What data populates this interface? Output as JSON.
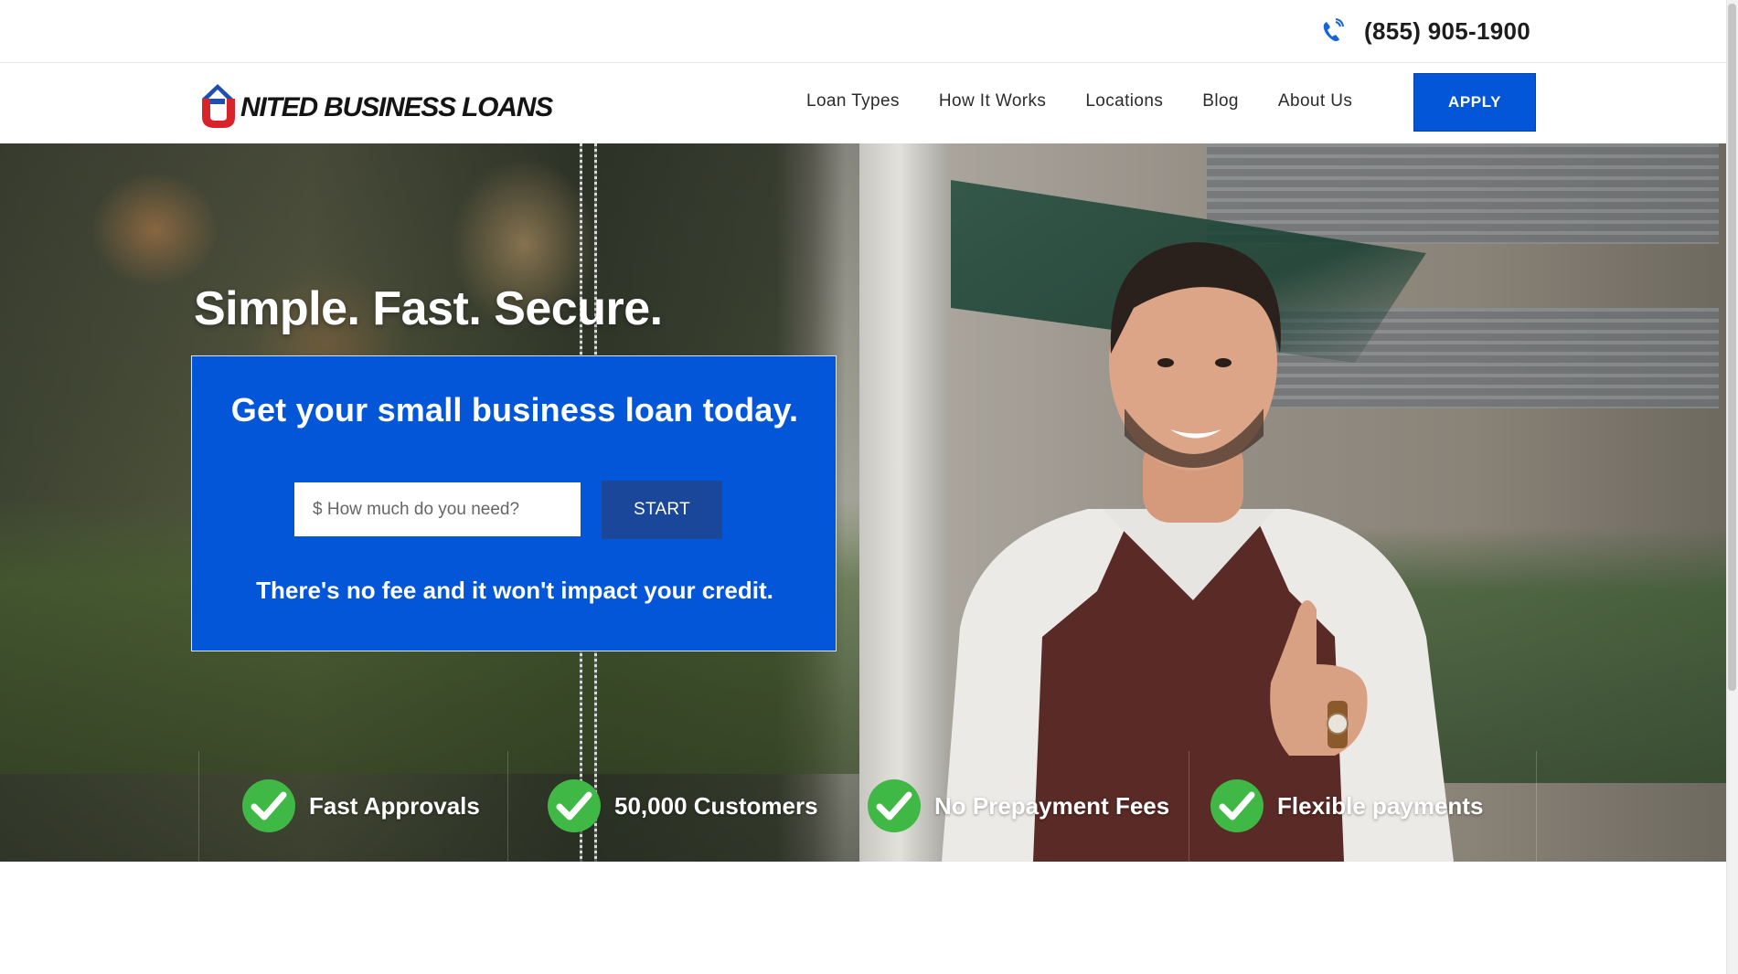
{
  "topbar": {
    "phone": "(855) 905-1900"
  },
  "header": {
    "logo_text": "NITED BUSINESS LOANS",
    "nav": [
      "Loan Types",
      "How It Works",
      "Locations",
      "Blog",
      "About Us"
    ],
    "apply_label": "APPLY"
  },
  "hero": {
    "title": "Simple. Fast. Secure.",
    "form": {
      "heading": "Get your small business loan today.",
      "amount_placeholder": "$ How much do you need?",
      "start_label": "START",
      "note": "There's no fee and it won't impact your credit."
    },
    "features": [
      "Fast Approvals",
      "50,000 Customers",
      "No Prepayment Fees",
      "Flexible payments"
    ]
  },
  "colors": {
    "brand_blue": "#0456d9",
    "start_button": "#1b479b",
    "logo_red": "#d8232a",
    "check_green": "#3fb845"
  }
}
